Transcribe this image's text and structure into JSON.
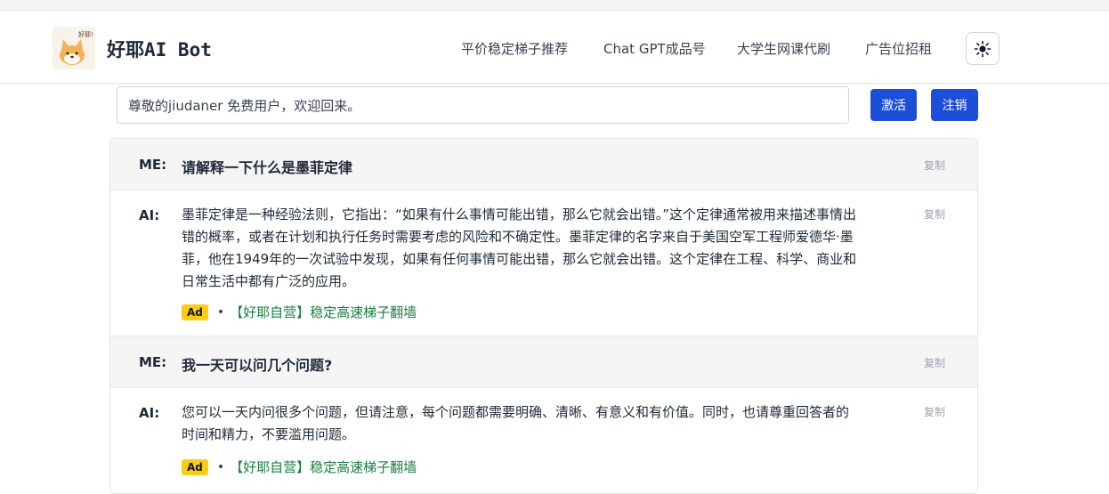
{
  "header": {
    "brand": "好耶AI Bot",
    "logo_text": "好耶!",
    "nav": [
      "平价稳定梯子推荐",
      "Chat GPT成品号",
      "大学生网课代刷",
      "广告位招租"
    ],
    "theme_icon": "sun-icon"
  },
  "account": {
    "welcome": "尊敬的jiudaner 免费用户，欢迎回来。",
    "activate_label": "激活",
    "logout_label": "注销"
  },
  "conversation": [
    {
      "role": "ME:",
      "text": "请解释一下什么是墨菲定律",
      "copy": "复制"
    },
    {
      "role": "AI:",
      "lines": [
        "墨菲定律是一种经验法则，它指出：“如果有什么事情可能出错，那么它就会出错。”这个定律通常被用来描述事情出",
        "错的概率，或者在计划和执行任务时需要考虑的风险和不确定性。墨菲定律的名字来自于美国空军工程师爱德华·墨",
        "菲，他在1949年的一次试验中发现，如果有任何事情可能出错，那么它就会出错。这个定律在工程、科学、商业和",
        "日常生活中都有广泛的应用。"
      ],
      "copy": "复制",
      "ad_badge": "Ad",
      "ad_dot": "•",
      "ad_text": "【好耶自营】稳定高速梯子翻墙"
    },
    {
      "role": "ME:",
      "text": "我一天可以问几个问题?",
      "copy": "复制"
    },
    {
      "role": "AI:",
      "lines": [
        "您可以一天内问很多个问题，但请注意，每个问题都需要明确、清晰、有意义和有价值。同时，也请尊重回答者的",
        "时间和精力，不要滥用问题。"
      ],
      "copy": "复制",
      "ad_badge": "Ad",
      "ad_dot": "•",
      "ad_text": "【好耶自营】稳定高速梯子翻墙"
    }
  ],
  "colors": {
    "primary": "#1d4ed8",
    "ad_badge": "#facc15",
    "ad_link": "#15803d",
    "me_row_bg": "#f5f5f5"
  }
}
